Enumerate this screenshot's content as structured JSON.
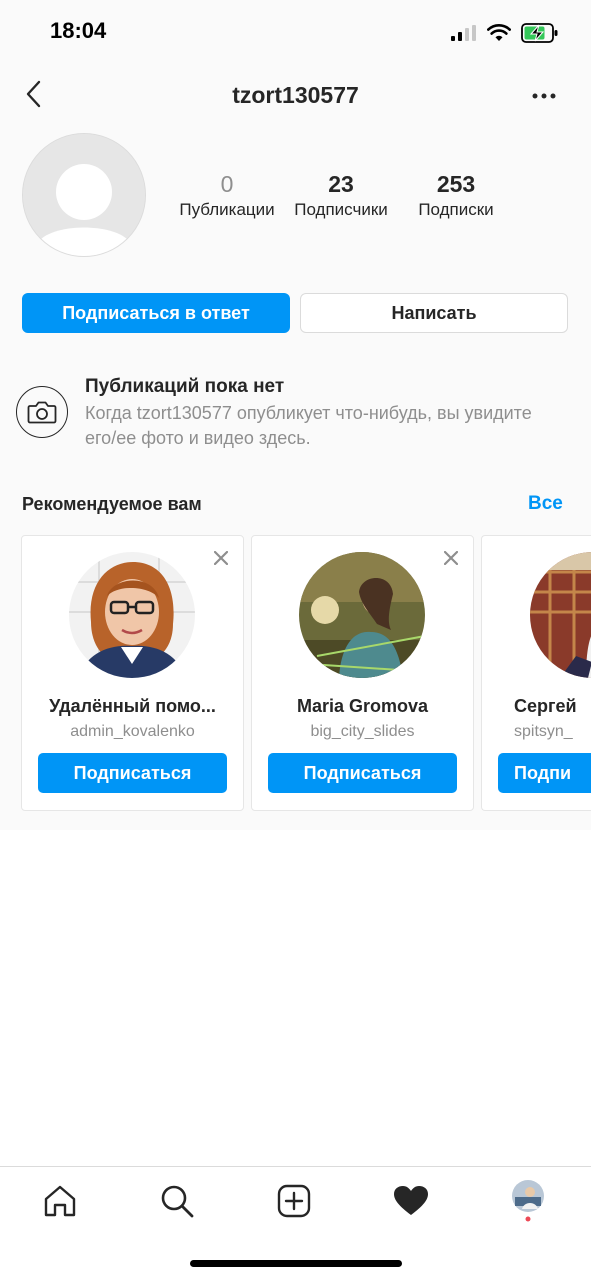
{
  "status_bar": {
    "time": "18:04"
  },
  "header": {
    "username": "tzort130577"
  },
  "stats": [
    {
      "value": "0",
      "label": "Публикации"
    },
    {
      "value": "23",
      "label": "Подписчики"
    },
    {
      "value": "253",
      "label": "Подписки"
    }
  ],
  "actions": {
    "follow_back": "Подписаться в ответ",
    "message": "Написать"
  },
  "empty_posts": {
    "title": "Публикаций пока нет",
    "text": "Когда tzort130577 опубликует что-нибудь, вы увидите его/ее фото и видео здесь."
  },
  "suggestions": {
    "title": "Рекомендуемое вам",
    "see_all": "Все",
    "cards": [
      {
        "name": "Удалённый помо...",
        "handle": "admin_kovalenko",
        "button": "Подписаться"
      },
      {
        "name": "Maria Gromova",
        "handle": "big_city_slides",
        "button": "Подписаться"
      },
      {
        "name": "Сергей",
        "handle": "spitsyn_",
        "button": "Подпи"
      }
    ]
  },
  "colors": {
    "accent": "#0095f6",
    "text": "#262626",
    "muted": "#8e8e8e",
    "border": "#dbdbdb"
  },
  "tabbar": {
    "icons": [
      "home-icon",
      "search-icon",
      "new-post-icon",
      "activity-heart-icon",
      "profile-avatar"
    ]
  }
}
